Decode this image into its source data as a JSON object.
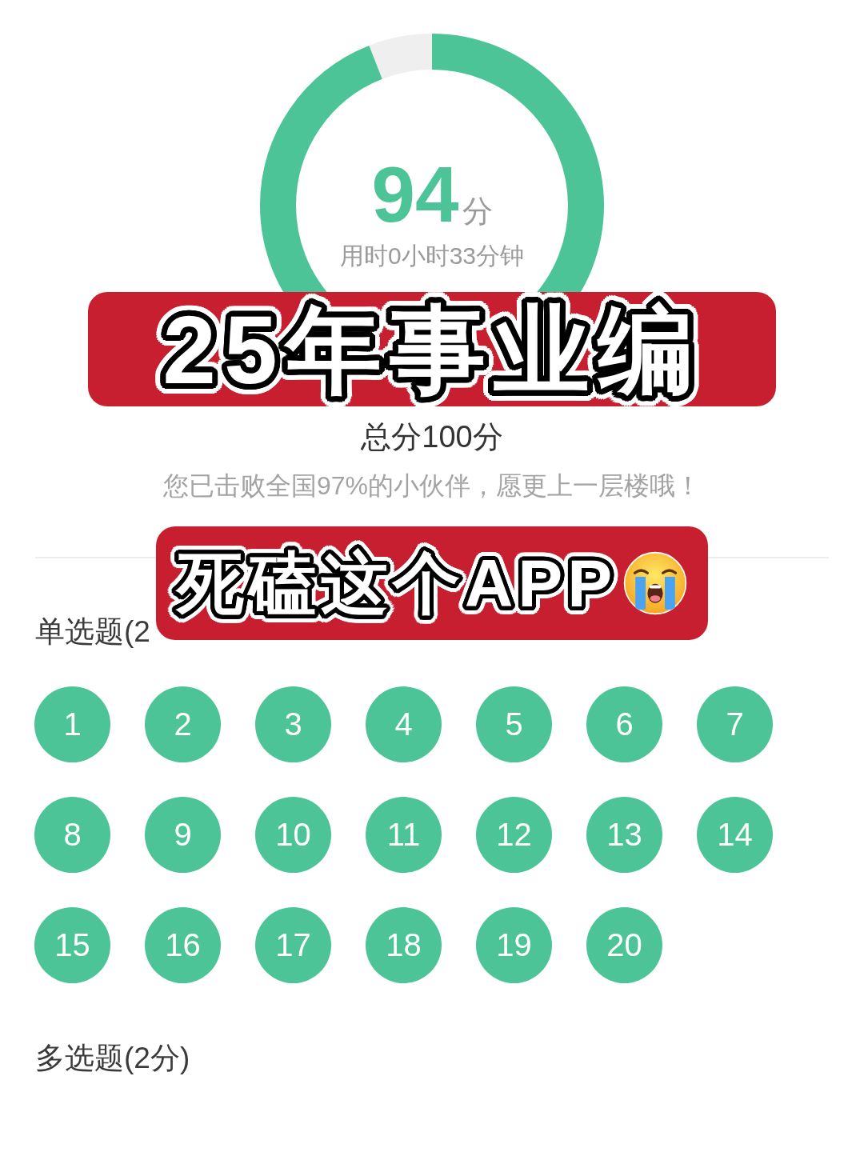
{
  "gauge": {
    "score": "94",
    "unit": "分",
    "duration": "用时0小时33分钟",
    "level": 0.94
  },
  "title_banner": {
    "text": "25年事业编"
  },
  "total": "总分100分",
  "ranking": "您已击败全国97%的小伙伴，愿更上一层楼哦！",
  "subtitle_banner": {
    "text": "死磕这个APP",
    "emoji": true
  },
  "sections": [
    {
      "title": "单选题(2",
      "questions": [
        {
          "number": "1",
          "correct": true
        },
        {
          "number": "2",
          "correct": true
        },
        {
          "number": "3",
          "correct": true
        },
        {
          "number": "4",
          "correct": true
        },
        {
          "number": "5",
          "correct": true
        },
        {
          "number": "6",
          "correct": true
        },
        {
          "number": "7",
          "correct": true
        },
        {
          "number": "8",
          "correct": true
        },
        {
          "number": "9",
          "correct": true
        },
        {
          "number": "10",
          "correct": true
        },
        {
          "number": "11",
          "correct": true
        },
        {
          "number": "12",
          "correct": true
        },
        {
          "number": "13",
          "correct": true
        },
        {
          "number": "14",
          "correct": true
        },
        {
          "number": "15",
          "correct": true
        },
        {
          "number": "16",
          "correct": true
        },
        {
          "number": "17",
          "correct": true
        },
        {
          "number": "18",
          "correct": true
        },
        {
          "number": "19",
          "correct": true
        },
        {
          "number": "20",
          "correct": true
        }
      ]
    },
    {
      "title": "多选题(2分)"
    }
  ]
}
